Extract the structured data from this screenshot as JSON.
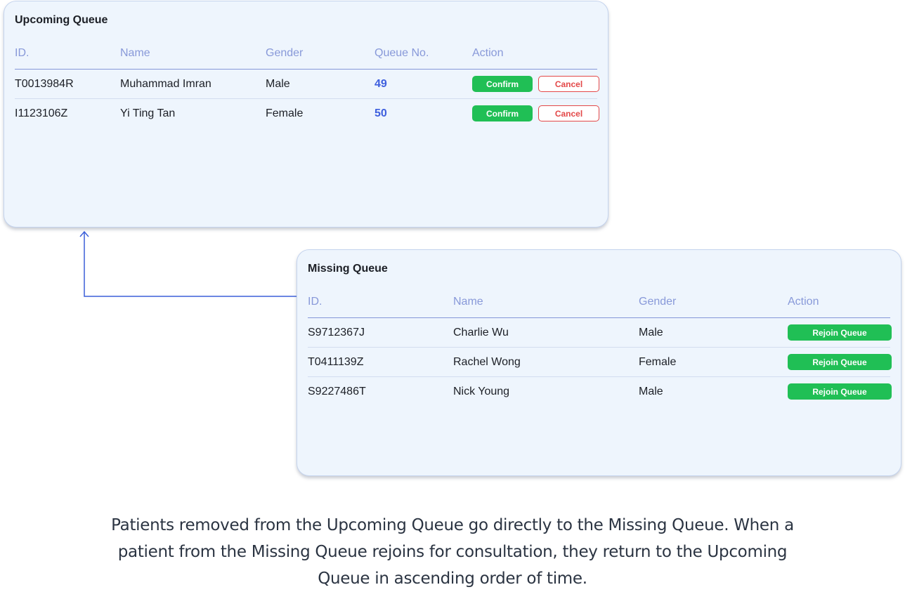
{
  "upcoming": {
    "title": "Upcoming Queue",
    "headers": {
      "id": "ID.",
      "name": "Name",
      "gender": "Gender",
      "queue_no": "Queue No.",
      "action": "Action"
    },
    "rows": [
      {
        "id": "T0013984R",
        "name": "Muhammad Imran",
        "gender": "Male",
        "queue_no": "49",
        "confirm_label": "Confirm",
        "cancel_label": "Cancel"
      },
      {
        "id": "I1123106Z",
        "name": "Yi Ting Tan",
        "gender": "Female",
        "queue_no": "50",
        "confirm_label": "Confirm",
        "cancel_label": "Cancel"
      }
    ]
  },
  "missing": {
    "title": "Missing Queue",
    "headers": {
      "id": "ID.",
      "name": "Name",
      "gender": "Gender",
      "action": "Action"
    },
    "rows": [
      {
        "id": "S9712367J",
        "name": "Charlie Wu",
        "gender": "Male",
        "rejoin_label": "Rejoin Queue"
      },
      {
        "id": "T0411139Z",
        "name": "Rachel Wong",
        "gender": "Female",
        "rejoin_label": "Rejoin Queue"
      },
      {
        "id": "S9227486T",
        "name": "Nick Young",
        "gender": "Male",
        "rejoin_label": "Rejoin Queue"
      }
    ]
  },
  "caption": {
    "line1": "Patients removed from the Upcoming Queue go directly to the Missing Queue. When a",
    "line2": "patient from the Missing Queue rejoins for consultation, they return to the Upcoming",
    "line3": "Queue in ascending order of time."
  },
  "colors": {
    "card_bg": "#eef5fd",
    "header_text": "#8899d9",
    "queue_number": "#3e5fde",
    "confirm_green": "#20bf55",
    "cancel_red": "#e34848",
    "arrow_blue": "#3b5fd9"
  }
}
